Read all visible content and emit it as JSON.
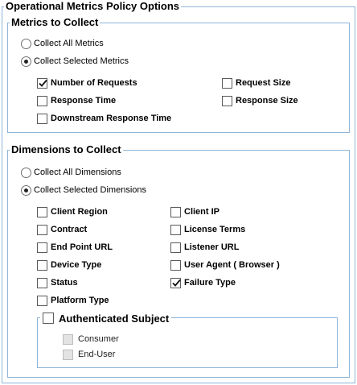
{
  "panel": {
    "title": "Operational Metrics Policy Options"
  },
  "metrics": {
    "legend": "Metrics to Collect",
    "radios": [
      {
        "label": "Collect All Metrics",
        "selected": false
      },
      {
        "label": "Collect Selected Metrics",
        "selected": true
      }
    ],
    "checkboxes": [
      {
        "label": "Number of Requests",
        "checked": true
      },
      {
        "label": "Response Time",
        "checked": false
      },
      {
        "label": "Downstream Response Time",
        "checked": false
      },
      {
        "label": "Request Size",
        "checked": false
      },
      {
        "label": "Response Size",
        "checked": false
      }
    ]
  },
  "dimensions": {
    "legend": "Dimensions to Collect",
    "radios": [
      {
        "label": "Collect All Dimensions",
        "selected": false
      },
      {
        "label": "Collect Selected Dimensions",
        "selected": true
      }
    ],
    "checkboxes": [
      {
        "label": "Client Region",
        "checked": false
      },
      {
        "label": "Contract",
        "checked": false
      },
      {
        "label": "End Point URL",
        "checked": false
      },
      {
        "label": "Device Type",
        "checked": false
      },
      {
        "label": "Status",
        "checked": false
      },
      {
        "label": "Platform Type",
        "checked": false
      },
      {
        "label": "Client IP",
        "checked": false
      },
      {
        "label": "License Terms",
        "checked": false
      },
      {
        "label": "Listener URL",
        "checked": false
      },
      {
        "label": "User Agent ( Browser )",
        "checked": false
      },
      {
        "label": "Failure Type",
        "checked": true
      }
    ],
    "authenticated_subject": {
      "label": "Authenticated Subject",
      "checked": false,
      "children": [
        {
          "label": "Consumer",
          "checked": false,
          "disabled": true
        },
        {
          "label": "End-User",
          "checked": false,
          "disabled": true
        }
      ]
    }
  },
  "colors": {
    "border": "#8eb4d8",
    "disabled_fill": "#e3e3e3"
  }
}
